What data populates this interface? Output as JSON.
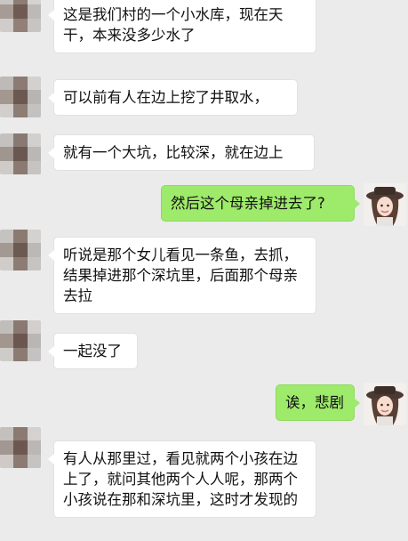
{
  "colors": {
    "background": "#ebebeb",
    "incoming_bubble": "#ffffff",
    "outgoing_bubble": "#9eea6a"
  },
  "messages": [
    {
      "side": "left",
      "text": "这是我们村的一个小水库，现在天干，本来没多少水了"
    },
    {
      "side": "left",
      "text": "可以前有人在边上挖了井取水，"
    },
    {
      "side": "left",
      "text": "就有一个大坑，比较深，就在边上"
    },
    {
      "side": "right",
      "text": "然后这个母亲掉进去了?"
    },
    {
      "side": "left",
      "text": "听说是那个女儿看见一条鱼，去抓，结果掉进那个深坑里，后面那个母亲去拉"
    },
    {
      "side": "left",
      "text": "一起没了"
    },
    {
      "side": "right",
      "text": "诶，悲剧"
    },
    {
      "side": "left",
      "text": "有人从那里过，看见就两个小孩在边上了，就问其他两个人人呢，那两个小孩说在那和深坑里，这时才发现的"
    }
  ],
  "icons": {
    "contact_avatar": "pixelated-avatar-icon",
    "user_avatar": "girl-hat-avatar-icon"
  }
}
